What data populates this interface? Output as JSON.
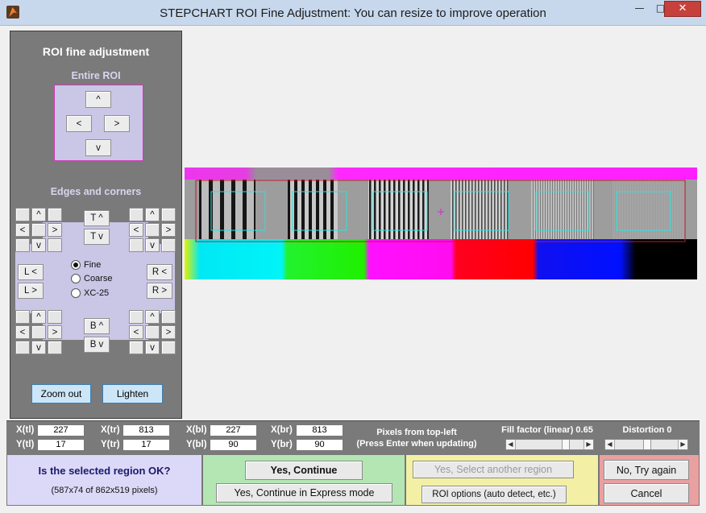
{
  "window": {
    "title": "STEPCHART ROI Fine Adjustment: You can resize to improve operation",
    "minimize": "—",
    "maximize": "□",
    "close": "✕"
  },
  "panel": {
    "heading": "ROI fine adjustment",
    "entire_roi": "Entire ROI",
    "entire_buttons": {
      "up": "^",
      "left": "<",
      "right": ">",
      "down": "v"
    },
    "edges_heading": "Edges and corners",
    "corner_up": "^",
    "corner_left": "<",
    "corner_right": ">",
    "corner_down": "v",
    "top_up": "T ^",
    "top_down": "T v",
    "left_left": "L  <",
    "left_right": "L  >",
    "right_left": "R  <",
    "right_right": "R  >",
    "bottom_up": "B ^",
    "bottom_down": "B v",
    "mode": {
      "fine": "Fine",
      "coarse": "Coarse",
      "xc25": "XC-25",
      "selected": "fine"
    },
    "zoom_out": "Zoom out",
    "lighten": "Lighten"
  },
  "coords": {
    "xtl_label": "X(tl)",
    "xtl": "227",
    "ytl_label": "Y(tl)",
    "ytl": "17",
    "xtr_label": "X(tr)",
    "xtr": "813",
    "ytr_label": "Y(tr)",
    "ytr": "17",
    "xbl_label": "X(bl)",
    "xbl": "227",
    "ybl_label": "Y(bl)",
    "ybl": "90",
    "xbr_label": "X(br)",
    "xbr": "813",
    "ybr_label": "Y(br)",
    "ybr": "90",
    "pixels_note_1": "Pixels from top-left",
    "pixels_note_2": "(Press Enter when updating)",
    "fill_factor_label": "Fill factor (linear) 0.65",
    "fill_factor_value": 0.65,
    "distortion_label": "Distortion 0",
    "distortion_value": 0
  },
  "decision": {
    "question": "Is the selected region OK?",
    "dims": "(587x74 of 862x519 pixels)",
    "yes_continue": "Yes, Continue",
    "yes_express": "Yes, Continue in Express mode",
    "yes_another": "Yes, Select another region",
    "roi_options": "ROI options (auto detect, etc.)",
    "no_try_again": "No, Try again",
    "cancel": "Cancel"
  },
  "colors": {
    "panel_gray": "#7a7a7a",
    "roi_box": "#c9c6e6",
    "selection_outline": "#c0182a",
    "roi_outline": "#29e3e0",
    "marker": "#e020e0"
  }
}
